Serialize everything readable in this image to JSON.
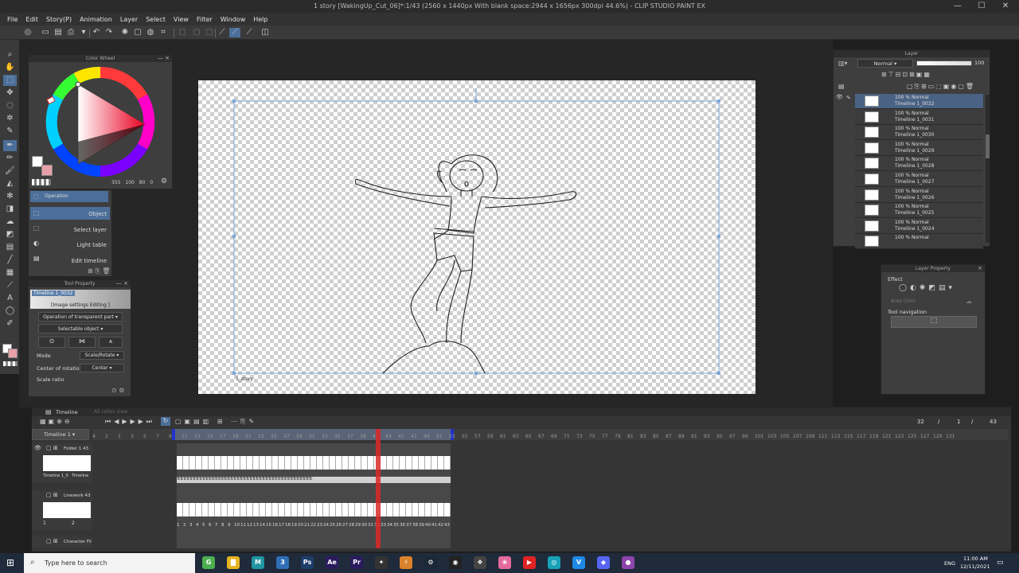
{
  "window": {
    "title": "1 story [WakingUp_Cut_06]*:1/43 (2560 x 1440px With blank space:2944 x 1656px 300dpi 44.6%) - CLIP STUDIO PAINT EX",
    "minimize": "—",
    "maximize": "☐",
    "close": "✕"
  },
  "menu": [
    "File",
    "Edit",
    "Story(P)",
    "Animation",
    "Layer",
    "Select",
    "View",
    "Filter",
    "Window",
    "Help"
  ],
  "color_wheel": {
    "title": "Color Wheel",
    "readout": [
      "355",
      "100",
      "80",
      "0"
    ],
    "main_color": "#ffffff",
    "sub_color": "#e8a0a8"
  },
  "sub_tools": {
    "header": "Operation",
    "items": [
      "Object",
      "Select layer",
      "Light table",
      "Edit timeline"
    ]
  },
  "tool_property": {
    "title": "Tool Property",
    "layer_name": "Timeline 1_0032",
    "editing_label": "[Image settings Editing ]",
    "transparent_op": "Operation of transparent part",
    "selectable": "Selectable object",
    "mode_label": "Mode",
    "mode_value": "Scale/Rotate",
    "center_label": "Center of rotation",
    "center_value": "Center",
    "scale_label": "Scale ratio"
  },
  "canvas": {
    "story_label": "1_story"
  },
  "layer_panel": {
    "title": "Layer",
    "blend": "Normal",
    "opacity": "100",
    "layers": [
      {
        "pct": "100 % Normal",
        "name": "Timeline 1_0032"
      },
      {
        "pct": "100 % Normal",
        "name": "Timeline 1_0031"
      },
      {
        "pct": "100 % Normal",
        "name": "Timeline 1_0030"
      },
      {
        "pct": "100 % Normal",
        "name": "Timeline 1_0029"
      },
      {
        "pct": "100 % Normal",
        "name": "Timeline 1_0028"
      },
      {
        "pct": "100 % Normal",
        "name": "Timeline 1_0027"
      },
      {
        "pct": "100 % Normal",
        "name": "Timeline 1_0026"
      },
      {
        "pct": "100 % Normal",
        "name": "Timeline 1_0025"
      },
      {
        "pct": "100 % Normal",
        "name": "Timeline 1_0024"
      },
      {
        "pct": "100 % Normal",
        "name": ""
      }
    ]
  },
  "layer_property": {
    "title": "Layer Property",
    "effect_label": "Effect",
    "area_color": "Area Color",
    "tool_navigation": "Tool navigation"
  },
  "timeline": {
    "tab": "Timeline",
    "tab2": "All cellos view",
    "name": "Timeline 1",
    "current_frame": "32",
    "start_frame": "1",
    "end_frame": "43",
    "slash": "/",
    "tracks": [
      {
        "name": "Folder 1 43",
        "thumb_label_a": "Timeline 1_0",
        "thumb_label_b": "Timeline"
      },
      {
        "name": "Linework 43",
        "thumb_label_a": "1",
        "thumb_label_b": "2"
      },
      {
        "name": "Character Fil",
        "thumb_label_a": "",
        "thumb_label_b": ""
      }
    ],
    "ruler": [
      "4",
      "2",
      "1",
      "3",
      "5",
      "7",
      "9",
      "11",
      "13",
      "15",
      "17",
      "19",
      "21",
      "23",
      "25",
      "27",
      "29",
      "31",
      "33",
      "35",
      "37",
      "39",
      "41",
      "43",
      "45",
      "47",
      "49",
      "51",
      "53",
      "55",
      "57",
      "59",
      "61",
      "63",
      "65",
      "67",
      "69",
      "71",
      "73",
      "75",
      "77",
      "79",
      "81",
      "83",
      "85",
      "87",
      "89",
      "91",
      "93",
      "95",
      "97",
      "99",
      "101",
      "103",
      "105",
      "107",
      "109",
      "111",
      "113",
      "115",
      "117",
      "119",
      "121",
      "123",
      "125",
      "127",
      "129",
      "131"
    ],
    "frame_numbers": [
      "1",
      "2",
      "3",
      "4",
      "5",
      "6",
      "7",
      "8",
      "9",
      "10",
      "11",
      "12",
      "13",
      "14",
      "15",
      "16",
      "17",
      "18",
      "19",
      "20",
      "21",
      "22",
      "23",
      "24",
      "25",
      "26",
      "27",
      "28",
      "29",
      "30",
      "31",
      "32",
      "33",
      "34",
      "35",
      "36",
      "37",
      "38",
      "39",
      "40",
      "41",
      "42",
      "43"
    ]
  },
  "taskbar": {
    "search_placeholder": "Type here to search",
    "time": "11:00 AM",
    "date": "12/11/2021",
    "lang": "ENG",
    "apps": [
      {
        "label": "G",
        "color": "#4caf50"
      },
      {
        "label": "▇",
        "color": "#e6b422"
      },
      {
        "label": "M",
        "color": "#2196a3"
      },
      {
        "label": "3",
        "color": "#2f6fb5"
      },
      {
        "label": "Ps",
        "color": "#1d3d6b"
      },
      {
        "label": "Ae",
        "color": "#2a1b5e"
      },
      {
        "label": "Pr",
        "color": "#2a1b5e"
      },
      {
        "label": "✦",
        "color": "#333333"
      },
      {
        "label": "⚡",
        "color": "#d9822b"
      },
      {
        "label": "⚙",
        "color": "#1b2838"
      },
      {
        "label": "◉",
        "color": "#222222"
      },
      {
        "label": "❖",
        "color": "#444444"
      },
      {
        "label": "❀",
        "color": "#e56b9e"
      },
      {
        "label": "▶",
        "color": "#e02424"
      },
      {
        "label": "◎",
        "color": "#17a2b8"
      },
      {
        "label": "V",
        "color": "#1e88e5"
      },
      {
        "label": "◆",
        "color": "#5865f2"
      },
      {
        "label": "●",
        "color": "#8e44ad"
      }
    ]
  }
}
